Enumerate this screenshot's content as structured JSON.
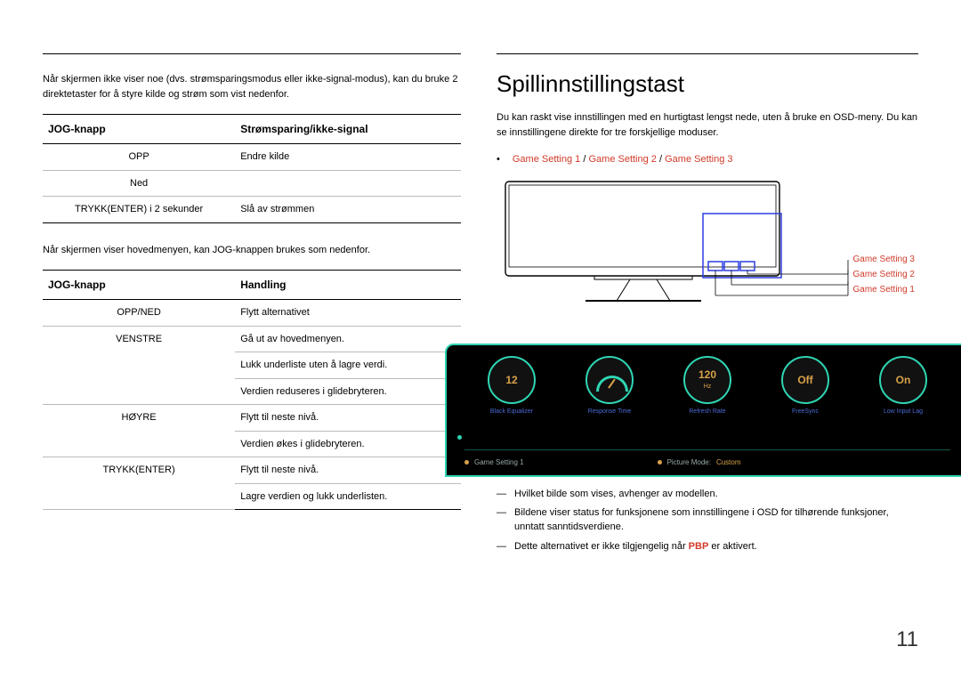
{
  "left": {
    "intro": "Når skjermen ikke viser noe (dvs. strømsparingsmodus eller ikke-signal-modus), kan du bruke 2 direktetaster for å styre kilde og strøm som vist nedenfor.",
    "table1": {
      "header_a": "JOG-knapp",
      "header_b": "Strømsparing/ikke-signal",
      "rows": [
        {
          "a": "OPP",
          "b": "Endre kilde"
        },
        {
          "a": "Ned",
          "b": ""
        },
        {
          "a": "TRYKK(ENTER) i 2 sekunder",
          "b": "Slå av strømmen"
        }
      ]
    },
    "between": "Når skjermen viser hovedmenyen, kan JOG-knappen brukes som nedenfor.",
    "table2": {
      "header_a": "JOG-knapp",
      "header_b": "Handling",
      "rows": [
        {
          "a": "OPP/NED",
          "b": "Flytt alternativet"
        },
        {
          "a": "VENSTRE",
          "b": "Gå ut av hovedmenyen.\nLukk underliste uten å lagre verdi.\nVerdien reduseres i glidebryteren.",
          "rows": 3
        },
        {
          "a": "HØYRE",
          "b": "Flytt til neste nivå.\nVerdien økes i glidebryteren.",
          "rows": 2
        },
        {
          "a": "TRYKK(ENTER)",
          "b": "Flytt til neste nivå.\nLagre verdien og lukk underlisten.",
          "rows": 2
        }
      ]
    }
  },
  "right": {
    "title": "Spillinnstillingstast",
    "desc": "Du kan raskt vise innstillingen med en hurtigtast lengst nede, uten å bruke en OSD-meny. Du kan se innstillingene direkte for tre forskjellige moduser.",
    "settings": [
      "Game Setting 1",
      "Game Setting 2",
      "Game Setting 3"
    ],
    "legend": [
      "Game Setting 3",
      "Game Setting 2",
      "Game Setting 1"
    ],
    "dials": [
      {
        "label": "Black Equalizer",
        "value": "12"
      },
      {
        "label": "Response Time",
        "gauge": true
      },
      {
        "label": "Refresh Rate",
        "value": "120",
        "sub": "Hz"
      },
      {
        "label": "FreeSync",
        "value": "Off"
      },
      {
        "label": "Low Input Lag",
        "value": "On"
      }
    ],
    "osd_row2_a": "Game Setting 1",
    "osd_row2_b_label": "Picture Mode:",
    "osd_row2_b_value": "Custom",
    "notes": [
      "Hvilket bilde som vises, avhenger av modellen.",
      "Bildene viser status for funksjonene som innstillingene i OSD for tilhørende funksjoner, unntatt sanntidsverdiene.",
      {
        "pre": "Dette alternativet er ikke tilgjengelig når ",
        "strong": "PBP",
        "post": " er aktivert."
      }
    ]
  },
  "page_number": "11"
}
